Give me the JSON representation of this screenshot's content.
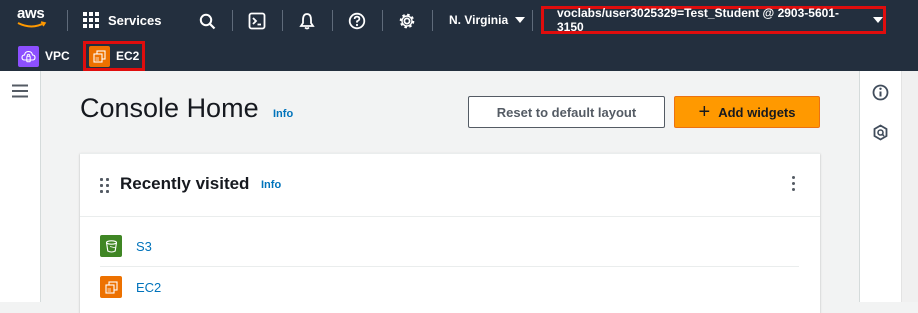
{
  "topbar": {
    "logo_text": "aws",
    "services_label": "Services",
    "region_label": "N. Virginia",
    "account_label": "voclabs/user3025329=Test_Student @ 2903-5601-3150",
    "icons": [
      "search-icon",
      "cloudshell-icon",
      "notifications-icon",
      "help-icon",
      "settings-icon"
    ]
  },
  "favorites": [
    {
      "label": "VPC",
      "color": "#8c4fff"
    },
    {
      "label": "EC2",
      "color": "#ed7100"
    }
  ],
  "main": {
    "title": "Console Home",
    "title_info": "Info",
    "reset_button": "Reset to default layout",
    "add_widgets_button": "Add widgets"
  },
  "recently_visited": {
    "title": "Recently visited",
    "info": "Info",
    "items": [
      {
        "label": "S3",
        "color": "#3f8624"
      },
      {
        "label": "EC2",
        "color": "#ed7100"
      }
    ]
  },
  "colors": {
    "nav_bg": "#232f3e",
    "accent": "#ff9900",
    "link": "#0073bb",
    "highlight_border": "#e00d0d"
  }
}
